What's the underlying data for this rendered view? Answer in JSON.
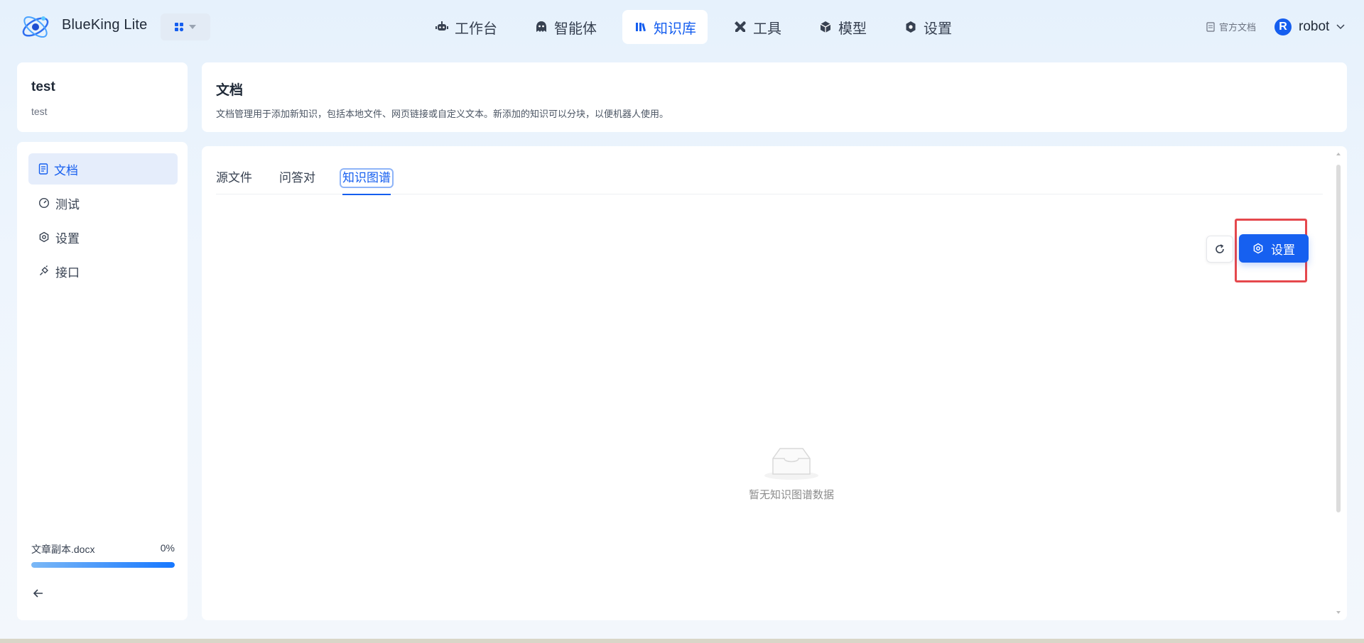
{
  "header": {
    "brand": "BlueKing Lite",
    "nav": [
      {
        "label": "工作台",
        "icon": "robot-icon"
      },
      {
        "label": "智能体",
        "icon": "agent-icon"
      },
      {
        "label": "知识库",
        "icon": "library-icon",
        "active": true
      },
      {
        "label": "工具",
        "icon": "tools-icon"
      },
      {
        "label": "模型",
        "icon": "cube-icon"
      },
      {
        "label": "设置",
        "icon": "gear-icon"
      }
    ],
    "doc_link": "官方文档",
    "user": {
      "initial": "R",
      "name": "robot"
    }
  },
  "knowledge_base": {
    "name": "test",
    "description": "test"
  },
  "sidebar": {
    "items": [
      {
        "label": "文档",
        "icon": "document-icon",
        "active": true
      },
      {
        "label": "测试",
        "icon": "gauge-icon"
      },
      {
        "label": "设置",
        "icon": "gear-icon"
      },
      {
        "label": "接口",
        "icon": "plug-icon"
      }
    ]
  },
  "upload": {
    "file_name": "文章副本.docx",
    "progress_text": "0%"
  },
  "main": {
    "title": "文档",
    "description": "文档管理用于添加新知识，包括本地文件、网页链接或自定义文本。新添加的知识可以分块，以便机器人使用。",
    "tabs": [
      {
        "label": "源文件"
      },
      {
        "label": "问答对"
      },
      {
        "label": "知识图谱",
        "active": true
      }
    ],
    "settings_button": "设置",
    "empty_text": "暂无知识图谱数据"
  },
  "colors": {
    "accent": "#155eef",
    "highlight": "#e5484d"
  }
}
